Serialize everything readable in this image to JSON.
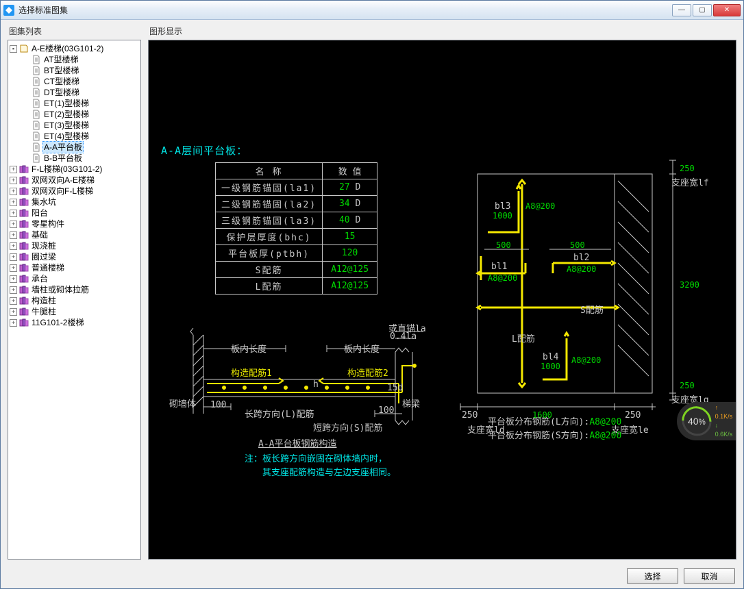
{
  "window": {
    "title": "选择标准图集"
  },
  "panes": {
    "tree_label": "图集列表",
    "canvas_label": "图形显示"
  },
  "tree": {
    "root": {
      "label": "A-E楼梯(03G101-2)",
      "children": [
        "AT型楼梯",
        "BT型楼梯",
        "CT型楼梯",
        "DT型楼梯",
        "ET(1)型楼梯",
        "ET(2)型楼梯",
        "ET(3)型楼梯",
        "ET(4)型楼梯",
        "A-A平台板",
        "B-B平台板"
      ],
      "selected": "A-A平台板"
    },
    "siblings": [
      "F-L楼梯(03G101-2)",
      "双网双向A-E楼梯",
      "双网双向F-L楼梯",
      "集水坑",
      "阳台",
      "零星构件",
      "基础",
      "现浇桩",
      "圈过梁",
      "普通楼梯",
      "承台",
      "墙柱或砌体拉筋",
      "构造柱",
      "牛腿柱",
      "11G101-2楼梯"
    ]
  },
  "buttons": {
    "ok": "选择",
    "cancel": "取消"
  },
  "cad": {
    "heading": "A-A层间平台板：",
    "table": {
      "header": [
        "名  称",
        "数  值"
      ],
      "rows": [
        {
          "name": "一级钢筋锚固(la1)",
          "val": "27",
          "unit": "D"
        },
        {
          "name": "二级钢筋锚固(la2)",
          "val": "34",
          "unit": "D"
        },
        {
          "name": "三级钢筋锚固(la3)",
          "val": "40",
          "unit": "D"
        },
        {
          "name": "保护层厚度(bhc)",
          "val": "15",
          "unit": ""
        },
        {
          "name": "平台板厚(ptbh)",
          "val": "120",
          "unit": ""
        },
        {
          "name": "S配筋",
          "val": "A12@125",
          "unit": ""
        },
        {
          "name": "L配筋",
          "val": "A12@125",
          "unit": ""
        }
      ]
    },
    "section": {
      "labels": {
        "wall": "砌墙体",
        "inner_len_left": "板内长度",
        "inner_len_right": "板内长度",
        "anchor": "或直锚la",
        "la04": "0.4la",
        "gz1": "构造配筋1",
        "gz2": "构造配筋2",
        "long_dir": "长跨方向(L)配筋",
        "short_dir": "短跨方向(S)配筋",
        "d100a": "100",
        "d100b": "100",
        "d15d": "15d",
        "h": "h",
        "beam": "梯梁",
        "caption": "A-A平台板钢筋构造"
      }
    },
    "plan": {
      "dims": {
        "w_left": "250",
        "w_mid": "1600",
        "w_right": "250",
        "h_top": "250",
        "h_mid": "3200",
        "h_bot": "250",
        "seat_ld": "支座宽ld",
        "seat_le": "支座宽le",
        "seat_lf": "支座宽lf",
        "seat_lg": "支座宽lg",
        "b_500a": "500",
        "b_500b": "500",
        "bl1": "bl1",
        "bl2": "bl2",
        "bl3": "bl3",
        "bl4": "bl4",
        "bl3v": "1000",
        "bl4v": "1000",
        "a8": "A8@200",
        "s_label": "S配筋",
        "l_label": "L配筋"
      }
    },
    "note": {
      "l1": "注：板长跨方向嵌固在砌体墙内时，",
      "l2": "其支座配筋构造与左边支座相同。"
    },
    "bottom": {
      "l1a": "平台板分布钢筋(L方向):",
      "l1b": "A8@200",
      "l2a": "平台板分布钢筋(S方向):",
      "l2b": "A8@200"
    }
  },
  "widget": {
    "pct": "40",
    "up": "0.1K/s",
    "dn": "0.6K/s"
  }
}
